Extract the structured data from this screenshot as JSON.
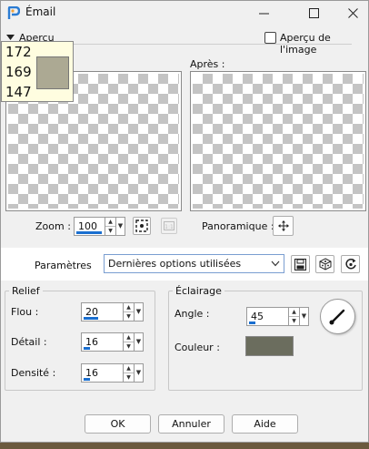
{
  "window": {
    "title": "Émail"
  },
  "preview": {
    "apercu_label": "Aperçu",
    "apercu_image_label": "Aperçu de l'image",
    "apres_label": "Après :"
  },
  "color_tooltip": {
    "r": "172",
    "g": "169",
    "b": "147",
    "swatch": "#aca993"
  },
  "zoom": {
    "label": "Zoom :",
    "value": "100"
  },
  "pan": {
    "label": "Panoramique :"
  },
  "presets": {
    "label": "Paramètres",
    "value": "Dernières options utilisées"
  },
  "relief": {
    "title": "Relief",
    "flou_label": "Flou :",
    "flou_value": "20",
    "detail_label": "Détail :",
    "detail_value": "16",
    "densite_label": "Densité :",
    "densite_value": "16"
  },
  "eclairage": {
    "title": "Éclairage",
    "angle_label": "Angle :",
    "angle_value": "45",
    "couleur_label": "Couleur :",
    "couleur_swatch": "#6b6d5e"
  },
  "buttons": {
    "ok": "OK",
    "cancel": "Annuler",
    "help": "Aide"
  },
  "icons": [
    "app-logo-icon",
    "minimize-icon",
    "maximize-icon",
    "close-icon",
    "collapse-arrow-icon",
    "zoom-fit-icon",
    "zoom-1to1-icon",
    "move-cross-icon",
    "save-preset-icon",
    "randomize-icon",
    "reset-icon",
    "angle-dial-icon"
  ]
}
